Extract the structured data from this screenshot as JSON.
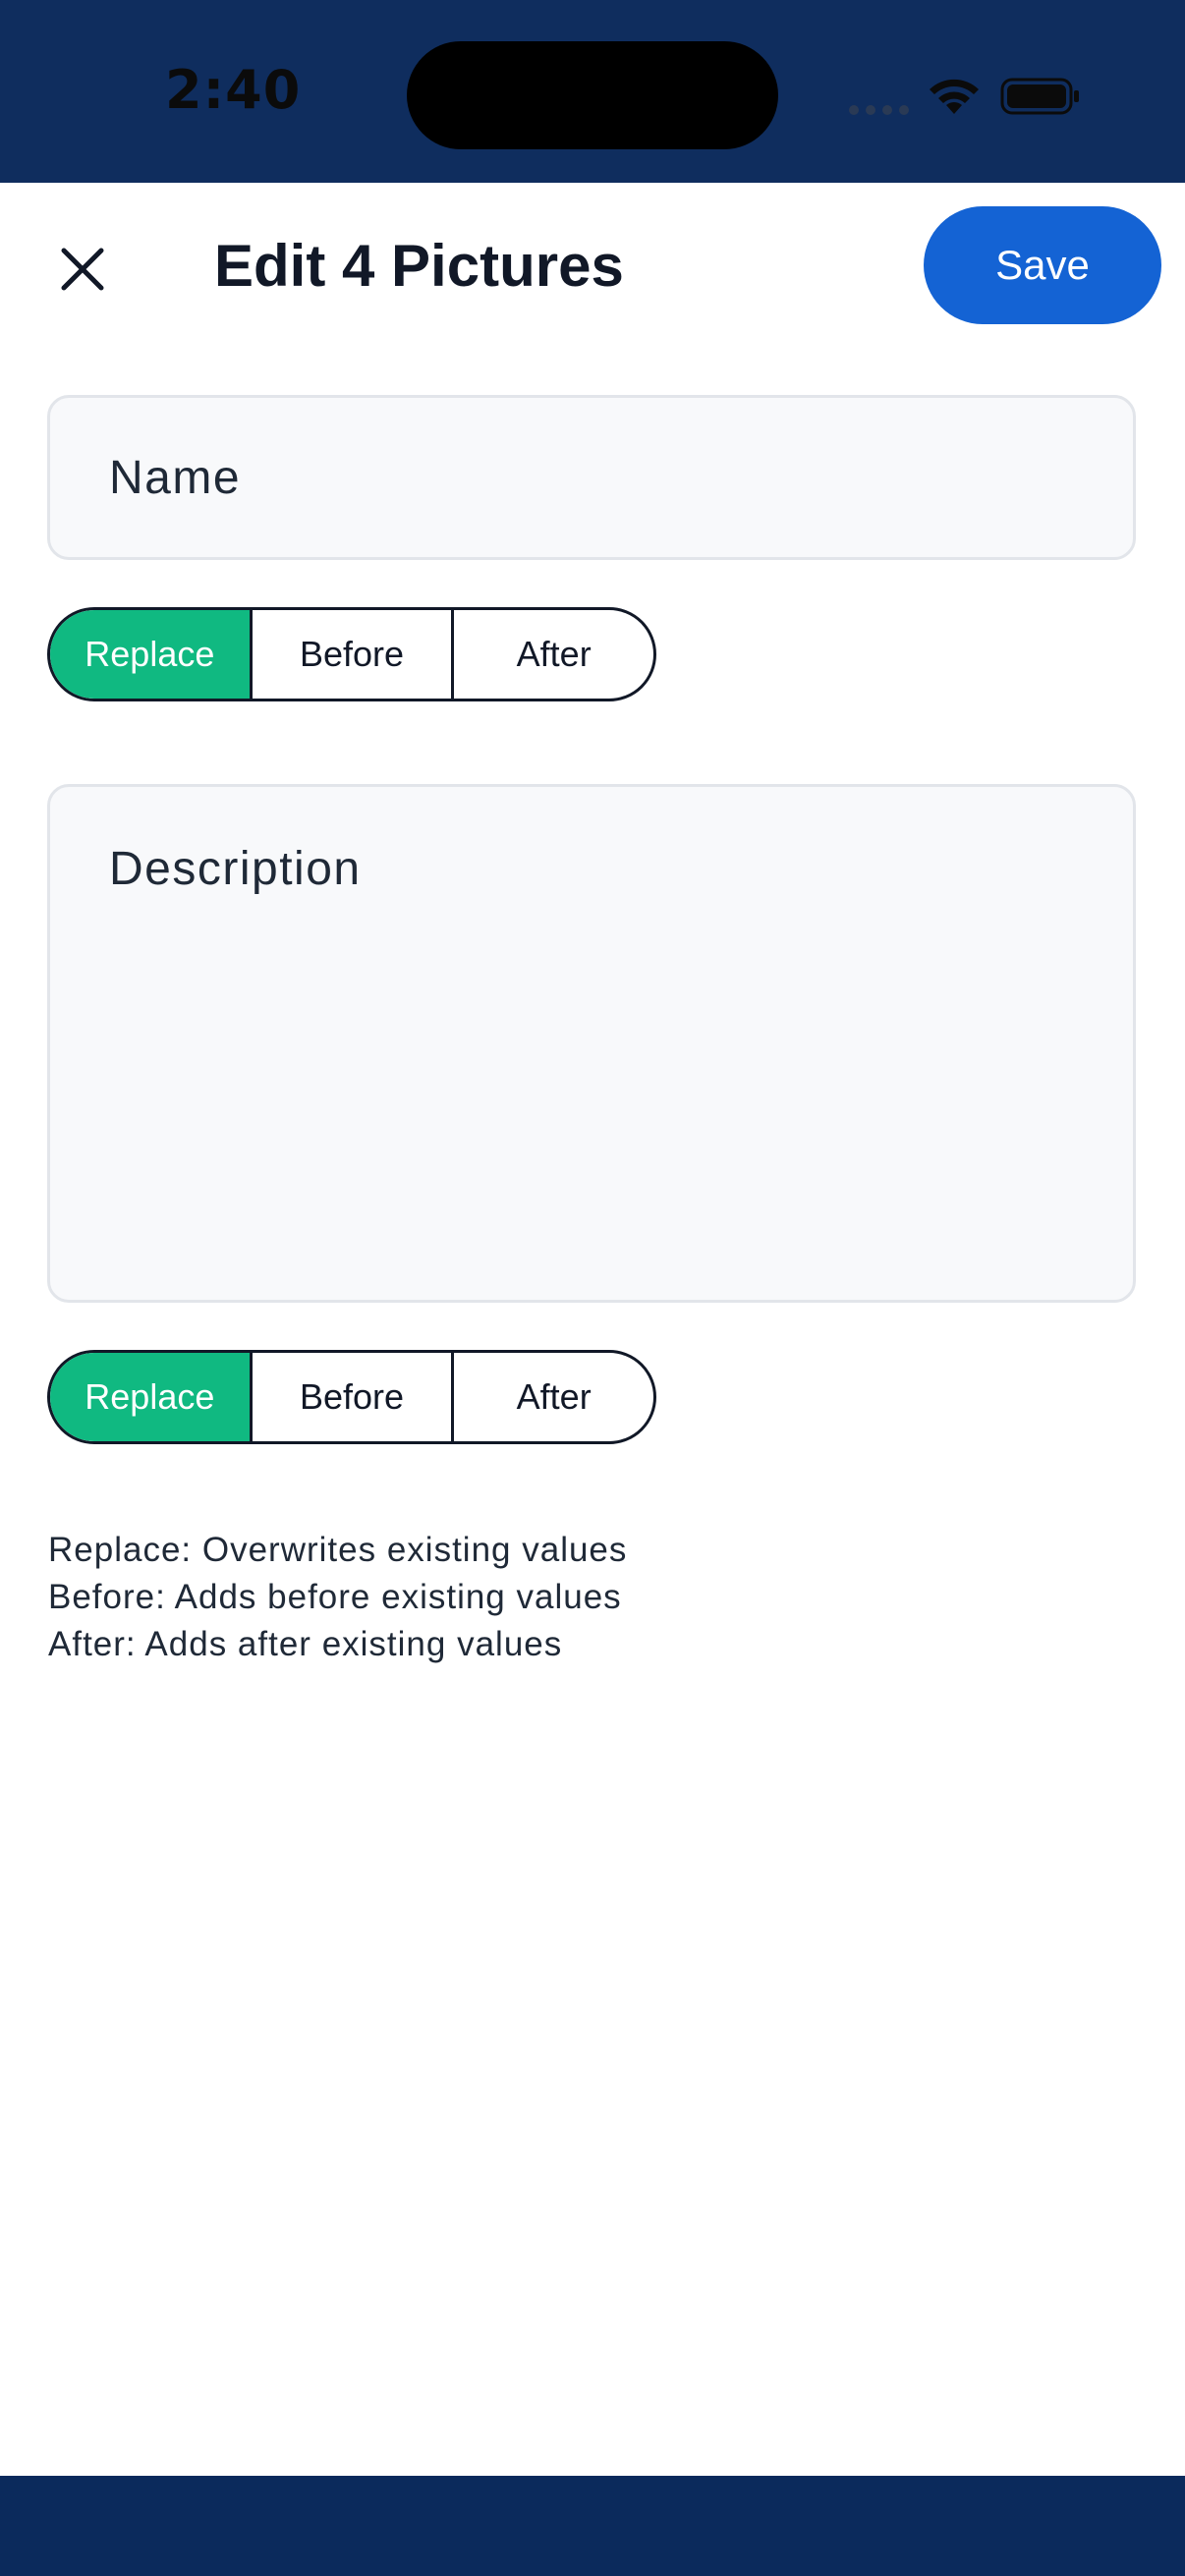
{
  "status_bar": {
    "time": "2:40",
    "icons": [
      "cellular-dots-icon",
      "wifi-icon",
      "battery-icon"
    ]
  },
  "header": {
    "close_icon": "close-icon",
    "title": "Edit 4 Pictures",
    "save_label": "Save"
  },
  "name_field": {
    "placeholder": "Name",
    "value": ""
  },
  "name_mode": {
    "options": [
      "Replace",
      "Before",
      "After"
    ],
    "selected": "Replace"
  },
  "description_field": {
    "placeholder": "Description",
    "value": ""
  },
  "description_mode": {
    "options": [
      "Replace",
      "Before",
      "After"
    ],
    "selected": "Replace"
  },
  "help": {
    "lines": [
      "Replace: Overwrites existing values",
      "Before: Adds before existing values",
      "After: Adds after existing values"
    ]
  },
  "colors": {
    "status_bar": "#0f2d5e",
    "accent": "#1463d4",
    "selected_segment": "#10b981",
    "field_background": "#f8f9fb"
  }
}
